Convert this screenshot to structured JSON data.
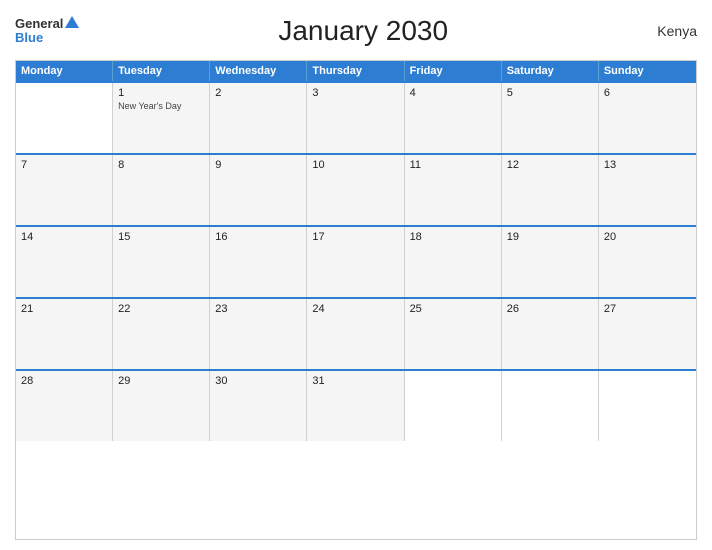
{
  "header": {
    "logo_general": "General",
    "logo_blue": "Blue",
    "title": "January 2030",
    "country": "Kenya"
  },
  "days": {
    "headers": [
      "Monday",
      "Tuesday",
      "Wednesday",
      "Thursday",
      "Friday",
      "Saturday",
      "Sunday"
    ]
  },
  "weeks": [
    [
      {
        "num": "",
        "empty": true
      },
      {
        "num": "1",
        "event": "New Year's Day"
      },
      {
        "num": "2"
      },
      {
        "num": "3"
      },
      {
        "num": "4"
      },
      {
        "num": "5"
      },
      {
        "num": "6"
      }
    ],
    [
      {
        "num": "7"
      },
      {
        "num": "8"
      },
      {
        "num": "9"
      },
      {
        "num": "10"
      },
      {
        "num": "11"
      },
      {
        "num": "12"
      },
      {
        "num": "13"
      }
    ],
    [
      {
        "num": "14"
      },
      {
        "num": "15"
      },
      {
        "num": "16"
      },
      {
        "num": "17"
      },
      {
        "num": "18"
      },
      {
        "num": "19"
      },
      {
        "num": "20"
      }
    ],
    [
      {
        "num": "21"
      },
      {
        "num": "22"
      },
      {
        "num": "23"
      },
      {
        "num": "24"
      },
      {
        "num": "25"
      },
      {
        "num": "26"
      },
      {
        "num": "27"
      }
    ],
    [
      {
        "num": "28"
      },
      {
        "num": "29"
      },
      {
        "num": "30"
      },
      {
        "num": "31"
      },
      {
        "num": "",
        "empty": true
      },
      {
        "num": "",
        "empty": true
      },
      {
        "num": "",
        "empty": true
      }
    ]
  ]
}
